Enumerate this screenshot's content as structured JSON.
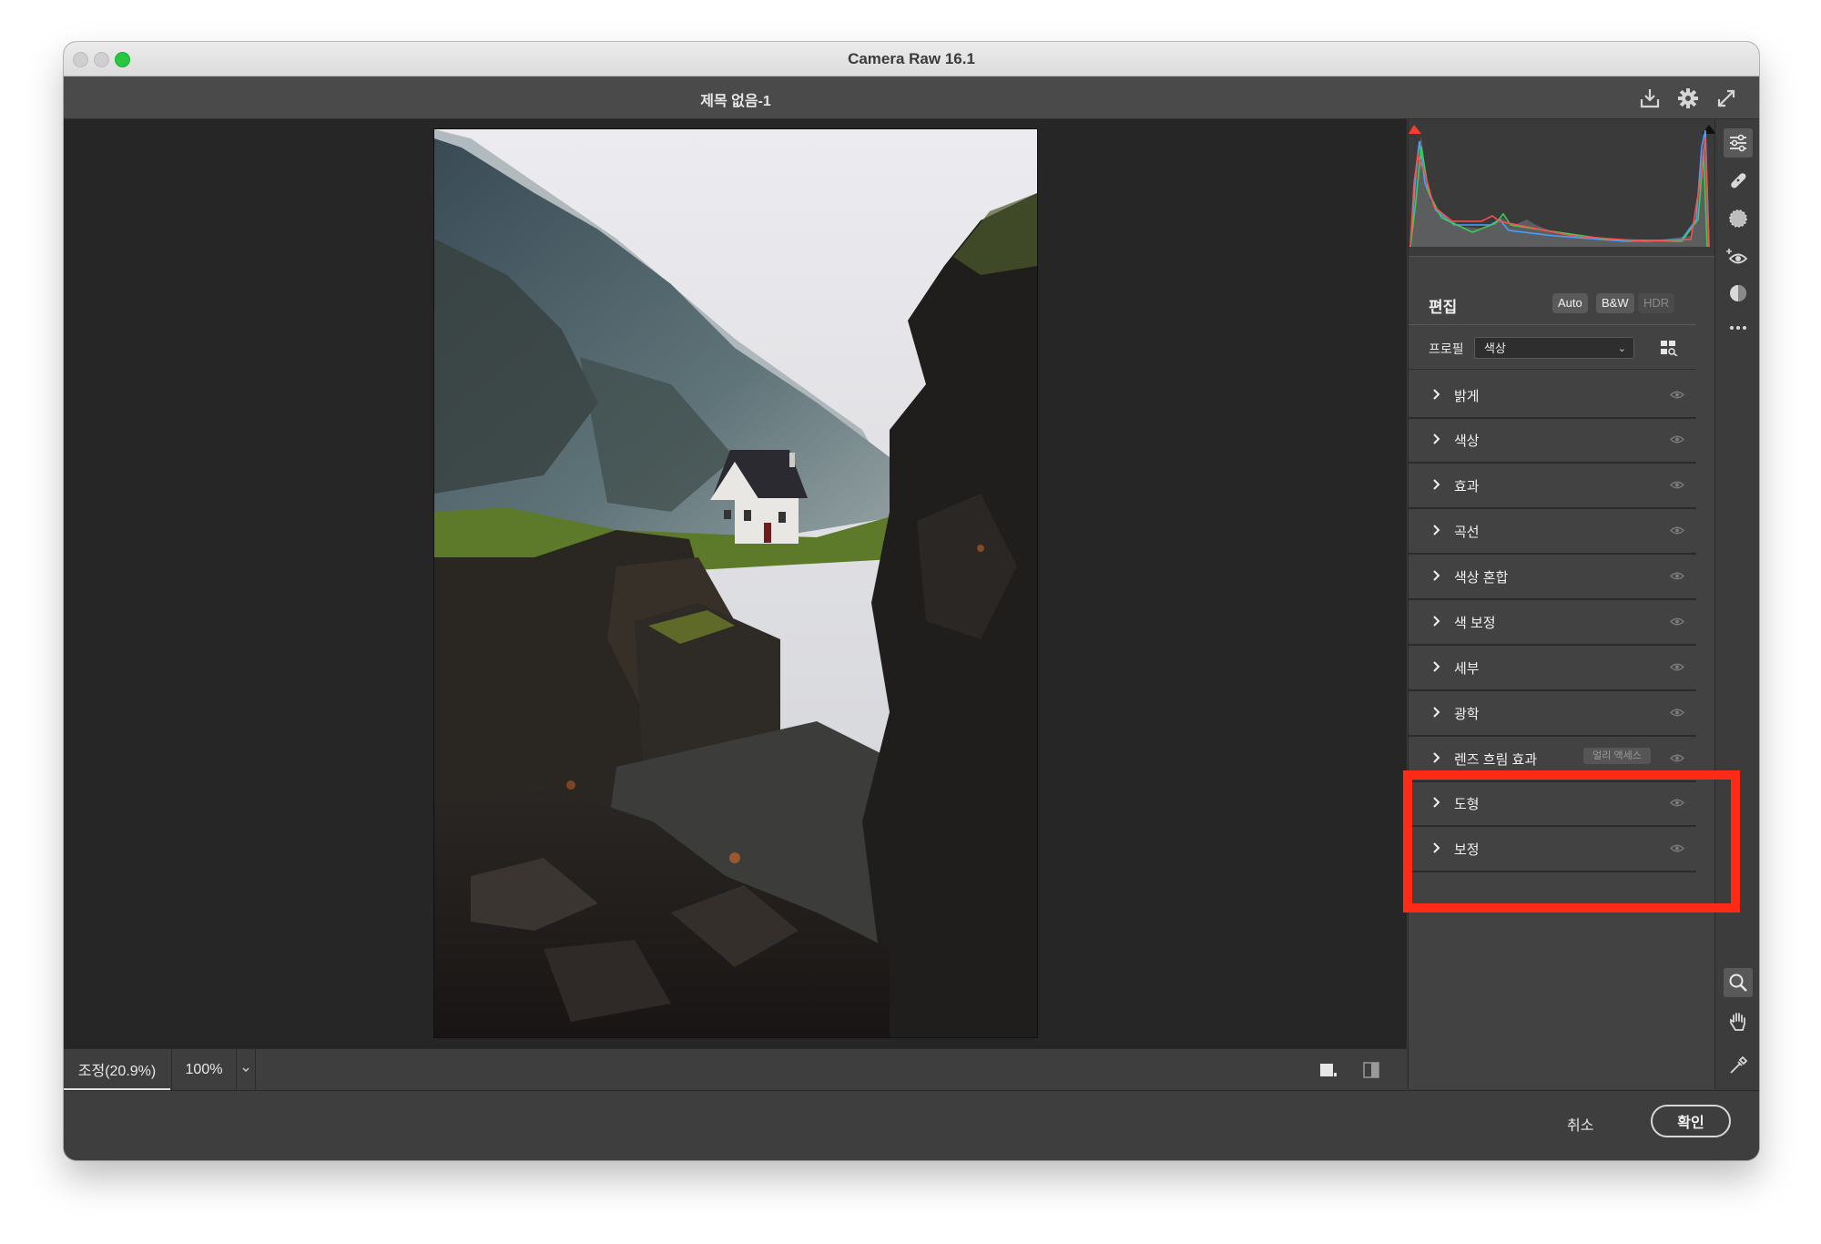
{
  "window": {
    "title": "Camera Raw 16.1"
  },
  "document": {
    "title": "제목 없음-1"
  },
  "top_icons": [
    "save-download-icon",
    "settings-gear-icon",
    "fullscreen-icon"
  ],
  "edit": {
    "title": "편집",
    "auto_label": "Auto",
    "bw_label": "B&W",
    "hdr_label": "HDR"
  },
  "profile": {
    "label": "프로필",
    "value": "색상"
  },
  "sections": [
    {
      "label": "밝게"
    },
    {
      "label": "색상"
    },
    {
      "label": "효과"
    },
    {
      "label": "곡선"
    },
    {
      "label": "색상 혼합"
    },
    {
      "label": "색 보정"
    },
    {
      "label": "세부"
    },
    {
      "label": "광학"
    },
    {
      "label": "렌즈 흐림 효과",
      "badge": "얼리 액세스"
    },
    {
      "label": "도형"
    },
    {
      "label": "보정"
    }
  ],
  "view": {
    "fit_label": "조정(20.9%)",
    "zoom_label": "100%"
  },
  "footer": {
    "cancel_label": "취소",
    "ok_label": "확인"
  },
  "tools_top": [
    "edit-sliders-icon",
    "healing-brush-icon",
    "masking-icon",
    "red-eye-icon",
    "presets-icon",
    "more-icon"
  ],
  "tools_bottom": [
    "zoom-icon",
    "hand-icon",
    "color-sampler-icon",
    "grid-overlay-icon"
  ],
  "colors": {
    "highlight": "#ff2b16",
    "panel": "#424242",
    "canvas": "#262626"
  }
}
